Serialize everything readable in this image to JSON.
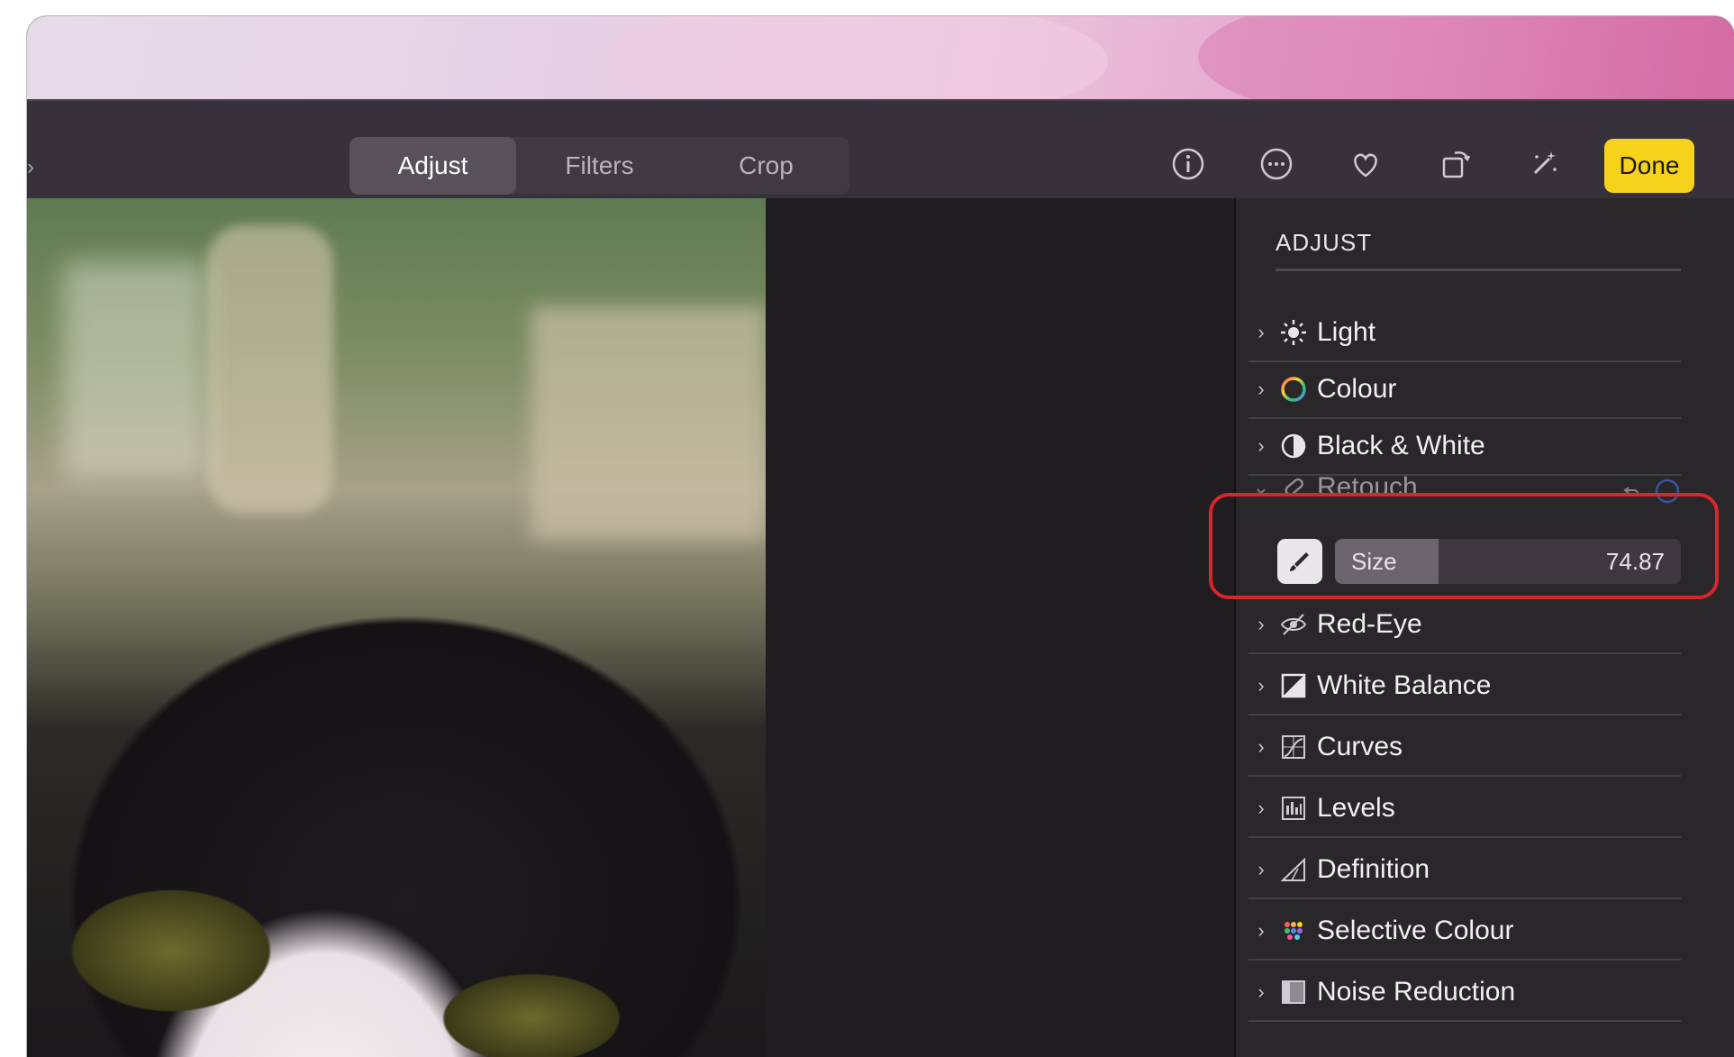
{
  "toolbar": {
    "tabs": [
      "Adjust",
      "Filters",
      "Crop"
    ],
    "active_tab": "Adjust",
    "icons": [
      "info-icon",
      "more-icon",
      "heart-icon",
      "rotate-icon",
      "magic-wand-icon"
    ],
    "done_label": "Done",
    "done_color": "#f7d21b"
  },
  "sidebar": {
    "title": "ADJUST",
    "items": [
      {
        "label": "Light",
        "icon": "sun-icon"
      },
      {
        "label": "Colour",
        "icon": "colour-wheel-icon"
      },
      {
        "label": "Black & White",
        "icon": "half-circle-icon"
      },
      {
        "label": "Retouch",
        "icon": "bandage-icon",
        "expanded": true
      },
      {
        "label": "Red-Eye",
        "icon": "eye-icon"
      },
      {
        "label": "White Balance",
        "icon": "white-balance-icon"
      },
      {
        "label": "Curves",
        "icon": "curves-icon"
      },
      {
        "label": "Levels",
        "icon": "levels-icon"
      },
      {
        "label": "Definition",
        "icon": "triangle-icon"
      },
      {
        "label": "Selective Colour",
        "icon": "dots-icon"
      },
      {
        "label": "Noise Reduction",
        "icon": "noise-icon"
      }
    ],
    "retouch": {
      "size_label": "Size",
      "size_value": "74.87",
      "size_fraction": 0.3
    }
  },
  "colors": {
    "highlight": "#d7262c",
    "sidebar_bg": "#2a272b",
    "toolbar_bg": "#36313a"
  }
}
